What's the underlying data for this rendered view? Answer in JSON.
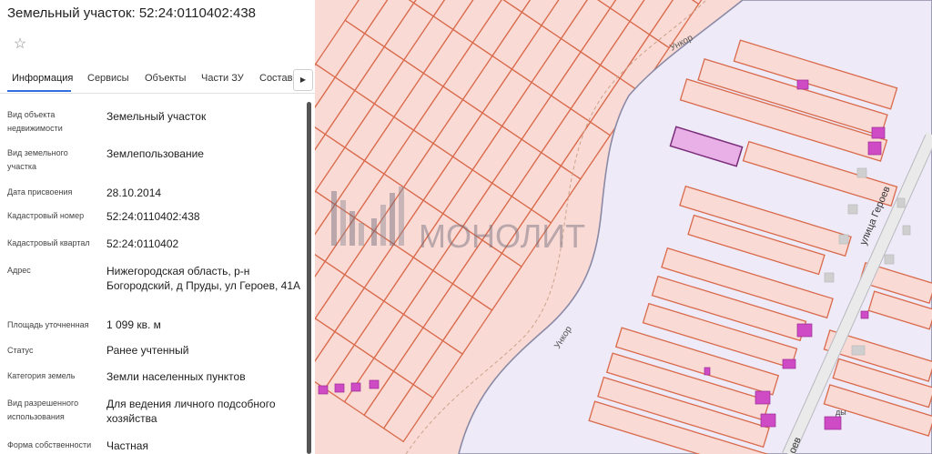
{
  "panel": {
    "title": "Земельный участок: 52:24:0110402:438",
    "favorite_icon": "star-outline-icon",
    "tabs": [
      {
        "label": "Информация",
        "active": true
      },
      {
        "label": "Сервисы",
        "active": false
      },
      {
        "label": "Объекты",
        "active": false
      },
      {
        "label": "Части ЗУ",
        "active": false
      },
      {
        "label": "Состав",
        "active": false
      }
    ],
    "tabs_more_icon": "chevron-right-icon",
    "rows": [
      {
        "label": "Вид объекта недвижимости",
        "value": "Земельный участок"
      },
      {
        "label": "Вид земельного участка",
        "value": "Землепользование"
      },
      {
        "label": "Дата присвоения",
        "value": "28.10.2014"
      },
      {
        "label": "Кадастровый номер",
        "value": "52:24:0110402:438"
      },
      {
        "label": "Кадастровый квартал",
        "value": "52:24:0110402"
      },
      {
        "label": "Адрес",
        "value": "Нижегородская область, р-н Богородский, д Пруды, ул Героев, 41А"
      },
      {
        "label": "Площадь уточненная",
        "value": "1 099 кв. м"
      },
      {
        "label": "Статус",
        "value": "Ранее учтенный"
      },
      {
        "label": "Категория земель",
        "value": "Земли населенных пунктов"
      },
      {
        "label": "Вид разрешенного использования",
        "value": "Для ведения личного подсобного хозяйства"
      },
      {
        "label": "Форма собственности",
        "value": "Частная"
      }
    ]
  },
  "map": {
    "river_labels": [
      "Ункор",
      "Ункор"
    ],
    "street_label": "улица Героев",
    "street_label_partial": "оев",
    "watermark_text": "МОНОЛИТ",
    "watermark_icon": "building-logo-icon",
    "small_label": "ды",
    "colors": {
      "parcel_fill": "#fadad4",
      "parcel_border": "#d96a4c",
      "river": "#eeeaf7",
      "building": "#cf4bc6",
      "selected_parcel": "#e8b0e6"
    }
  }
}
